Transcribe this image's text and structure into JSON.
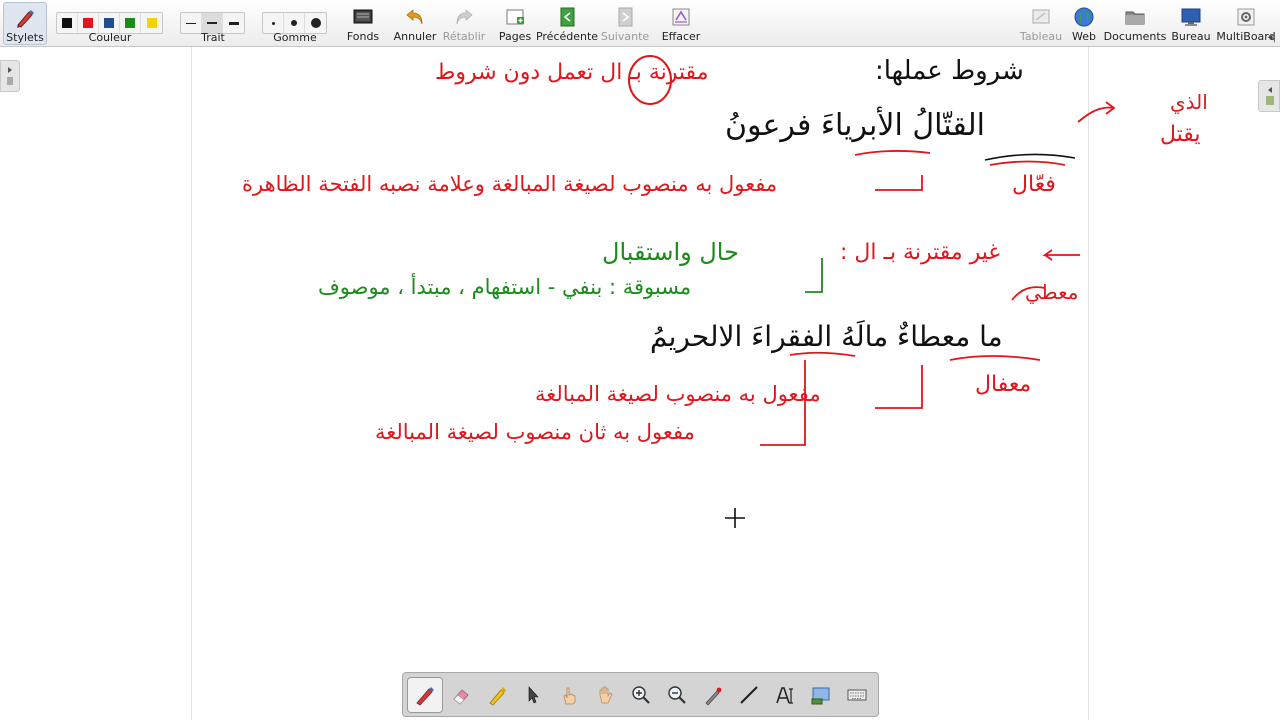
{
  "toolbar": {
    "stylets": "Stylets",
    "couleur": "Couleur",
    "trait": "Trait",
    "gomme": "Gomme",
    "fonds": "Fonds",
    "annuler": "Annuler",
    "retablir": "Rétablir",
    "pages": "Pages",
    "precedente": "Précédente",
    "suivante": "Suivante",
    "effacer": "Effacer",
    "tableau": "Tableau",
    "web": "Web",
    "documents": "Documents",
    "bureau": "Bureau",
    "multiboard": "MultiBoard"
  },
  "colors": {
    "swatches": [
      "#111111",
      "#e0161b",
      "#1f4f8f",
      "#1a8c1a",
      "#f5d300"
    ],
    "ink_black": "#111111",
    "ink_red": "#e0161b",
    "ink_green": "#1a8c1a"
  },
  "board": {
    "line1_black": "شروط عملها:",
    "line1_red": "مقترنة بـ ال تعمل دون شروط",
    "line2_black": "القتّالُ الأبرياءَ فرعونُ",
    "side_note_1": "الذي",
    "side_note_2": "يقتل",
    "line3_red_1": "فعّال",
    "line3_red_2": "مفعول به منصوب لصيغة المبالغة وعلامة نصبه الفتحة الظاهرة",
    "line4_red": "غير مقترنة بـ ال :",
    "line4_green": "حال واستقبال",
    "line5_green": "مسبوقة : بنفي - استفهام ، مبتدأ ، موصوف",
    "side_note_3": "معطي",
    "line6_black": "ما معطاءٌ مالَهُ الفقراءَ الالحريمُ",
    "line7_red_1": "معفال",
    "line7_red_2": "مفعول به منصوب لصيغة المبالغة",
    "line8_red": "مفعول به ثان منصوب لصيغة المبالغة"
  },
  "bottom_tools": [
    "pen-icon",
    "eraser-icon",
    "highlighter-icon",
    "pointer-icon",
    "hand-pointer-icon",
    "pan-hand-icon",
    "zoom-in-icon",
    "zoom-out-icon",
    "laser-pointer-icon",
    "line-icon",
    "text-tool-icon",
    "screen-capture-icon",
    "keyboard-icon"
  ]
}
